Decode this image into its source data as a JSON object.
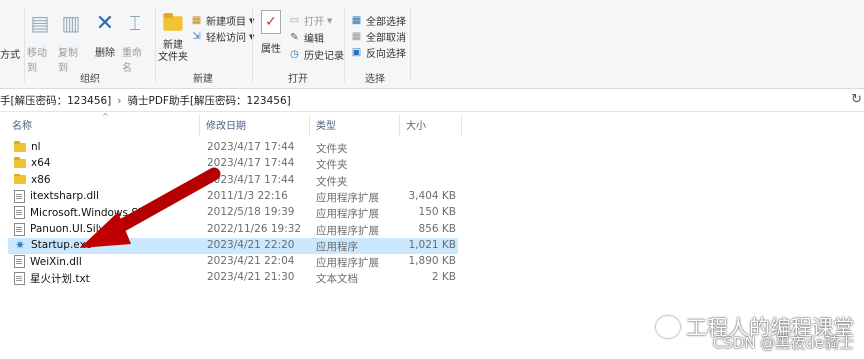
{
  "ribbon": {
    "clip_left": "方式",
    "organize": {
      "label": "组织",
      "move_to": "移动到",
      "copy_to": "复制到",
      "delete": "删除",
      "rename": "重命名"
    },
    "new": {
      "label": "新建",
      "new_folder": "新建\n文件夹",
      "new_item": "新建项目",
      "easy_access": "轻松访问"
    },
    "open": {
      "label": "打开",
      "properties": "属性",
      "open": "打开",
      "edit": "编辑",
      "history": "历史记录"
    },
    "select": {
      "label": "选择",
      "select_all": "全部选择",
      "select_none": "全部取消",
      "invert": "反向选择"
    }
  },
  "address": {
    "seg1": "手[解压密码：123456]",
    "seg2": "骑士PDF助手[解压密码：123456]"
  },
  "columns": {
    "name": "名称",
    "date": "修改日期",
    "type": "类型",
    "size": "大小"
  },
  "files": [
    {
      "name": "nl",
      "date": "2023/4/17 17:44",
      "type": "文件夹",
      "size": "",
      "icon": "folder"
    },
    {
      "name": "x64",
      "date": "2023/4/17 17:44",
      "type": "文件夹",
      "size": "",
      "icon": "folder"
    },
    {
      "name": "x86",
      "date": "2023/4/17 17:44",
      "type": "文件夹",
      "size": "",
      "icon": "folder"
    },
    {
      "name": "itextsharp.dll",
      "date": "2011/1/3 22:16",
      "type": "应用程序扩展",
      "size": "3,404 KB",
      "icon": "file"
    },
    {
      "name": "Microsoft.Windows.Sh",
      "date": "2012/5/18 19:39",
      "type": "应用程序扩展",
      "size": "150 KB",
      "icon": "file"
    },
    {
      "name": "Panuon.UI.Silver",
      "date": "2022/11/26 19:32",
      "type": "应用程序扩展",
      "size": "856 KB",
      "icon": "file"
    },
    {
      "name": "Startup.exe",
      "date": "2023/4/21 22:20",
      "type": "应用程序",
      "size": "1,021 KB",
      "icon": "exe",
      "selected": true
    },
    {
      "name": "WeiXin.dll",
      "date": "2023/4/21 22:04",
      "type": "应用程序扩展",
      "size": "1,890 KB",
      "icon": "file"
    },
    {
      "name": "星火计划.txt",
      "date": "2023/4/21 21:30",
      "type": "文本文档",
      "size": "2 KB",
      "icon": "file"
    }
  ],
  "watermark": {
    "line1": "工程人的编程课堂",
    "line2": "CSDN @黑夜de骑士"
  },
  "colors": {
    "selection": "#cce8ff",
    "arrow": "#c00000",
    "ribbon_bg": "#f5f6f7"
  }
}
